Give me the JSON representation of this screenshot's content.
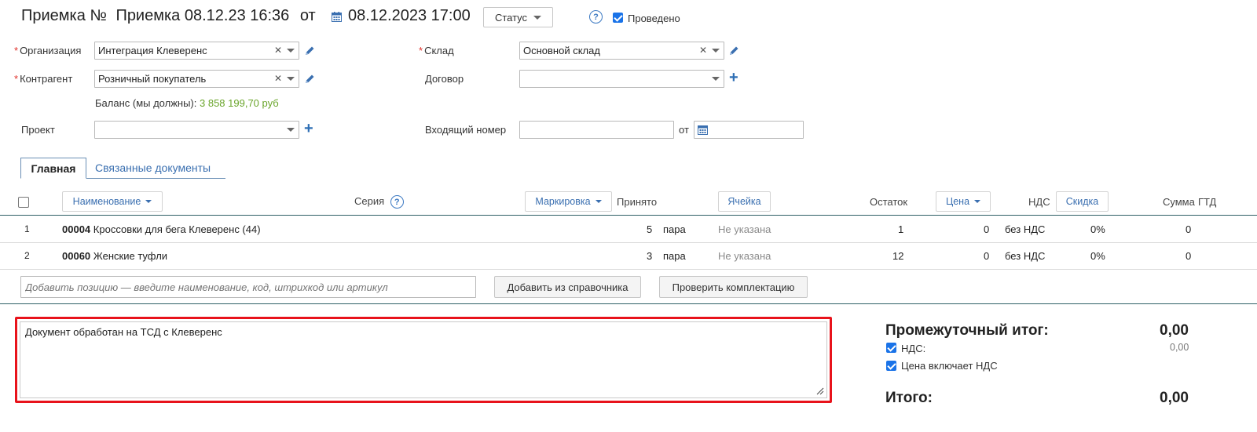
{
  "header": {
    "doc_prefix": "Приемка №",
    "doc_name": "Приемка 08.12.23 16:36",
    "from_label": "от",
    "date_value": "08.12.2023 17:00",
    "status_label": "Статус",
    "posted_label": "Проведено"
  },
  "form": {
    "org_label": "Организация",
    "org_value": "Интеграция Клеверенс",
    "warehouse_label": "Склад",
    "warehouse_value": "Основной склад",
    "counterparty_label": "Контрагент",
    "counterparty_value": "Розничный покупатель",
    "contract_label": "Договор",
    "contract_value": "",
    "balance_label": "Баланс (мы должны):",
    "balance_value": "3 858 199,70 руб",
    "project_label": "Проект",
    "project_value": "",
    "incoming_label": "Входящий номер",
    "incoming_value": "",
    "incoming_from_label": "от",
    "incoming_date": ""
  },
  "tabs": [
    {
      "label": "Главная",
      "active": true
    },
    {
      "label": "Связанные документы",
      "active": false
    }
  ],
  "table": {
    "headers": {
      "name": "Наименование",
      "series": "Серия",
      "marking": "Маркировка",
      "accepted": "Принято",
      "cell": "Ячейка",
      "remainder": "Остаток",
      "price": "Цена",
      "vat": "НДС",
      "discount": "Скидка",
      "sum": "Сумма",
      "gtd": "ГТД"
    },
    "rows": [
      {
        "num": "1",
        "code": "00004",
        "name": "Кроссовки для бега Клеверенс (44)",
        "qty": "5",
        "unit": "пара",
        "cell": "Не указана",
        "remainder": "1",
        "price": "0",
        "vat": "без НДС",
        "discount": "0%",
        "sum": "0"
      },
      {
        "num": "2",
        "code": "00060",
        "name": "Женские туфли",
        "qty": "3",
        "unit": "пара",
        "cell": "Не указана",
        "remainder": "12",
        "price": "0",
        "vat": "без НДС",
        "discount": "0%",
        "sum": "0"
      }
    ]
  },
  "add_row": {
    "placeholder": "Добавить позицию — введите наименование, код, штрихкод или артикул",
    "from_catalog": "Добавить из справочника",
    "check_set": "Проверить комплектацию"
  },
  "comment": "Документ обработан на ТСД с Клеверенс",
  "totals": {
    "subtotal_label": "Промежуточный итог:",
    "subtotal_value": "0,00",
    "vat_label": "НДС:",
    "vat_value": "0,00",
    "price_incl_vat_label": "Цена включает НДС",
    "total_label": "Итого:",
    "total_value": "0,00"
  },
  "colors": {
    "accent": "#3a6fb0",
    "required": "#e0312b",
    "balance": "#6aa52b",
    "highlight": "#e8131b",
    "table_line": "#2e5f66"
  }
}
